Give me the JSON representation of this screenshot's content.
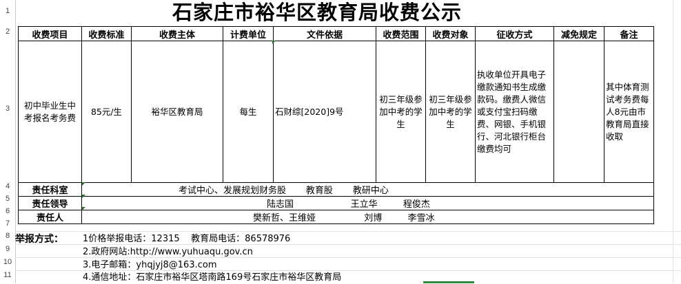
{
  "sheet": {
    "title": "石家庄市裕华区教育局收费公示",
    "row_numbers": [
      "1",
      "2",
      "3",
      "4",
      "5",
      "6",
      "7",
      "8",
      "9",
      "10",
      "11"
    ]
  },
  "table": {
    "headers": [
      "收费项目",
      "收费标准",
      "收费主体",
      "计费单位",
      "文件依据",
      "收费范围",
      "收费对象",
      "征收方式",
      "减免规定",
      "备注"
    ],
    "row": [
      "初中毕业生中考报名考务费",
      "85元/生",
      "裕华区教育局",
      "每生",
      "石财综[2020]9号",
      "初三年级参加中考的学生",
      "初三年级参加中考的学生",
      "执收单位开具电子缴款通知书生成缴款码。缴费人微信或支付宝扫码缴费、网银、手机银行、河北银行柜台缴费均可",
      "",
      "其中体育测试考务费每人8元由市教育局直接收取"
    ],
    "responsibility": [
      {
        "label": "责任科室",
        "value": "考试中心、发展规划财务股       教育股       教研中心"
      },
      {
        "label": "责任领导",
        "value": "陆志国                    王立华         程俊杰"
      },
      {
        "label": "责任人",
        "value": "樊新哲、王维娅                 刘博         李雪冰"
      }
    ]
  },
  "report": {
    "label": "举报方式：",
    "lines": [
      "1价格举报电话：12315    教育局电话：86578976",
      "2.政府网站:http://www.yuhuaqu.gov.cn",
      "3.电子邮箱：yhqjyj8@163.com",
      "4.通信地址：石家庄市裕华区塔南路169号石家庄市裕华区教育局"
    ]
  }
}
